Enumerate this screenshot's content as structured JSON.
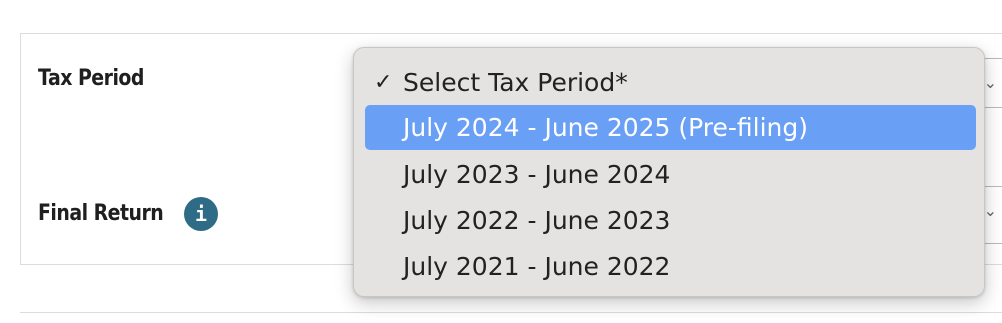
{
  "form": {
    "tax_period_label": "Tax Period",
    "final_return_label": "Final Return",
    "info_icon_glyph": "i"
  },
  "dropdown": {
    "check_glyph": "✓",
    "options": [
      {
        "label": "Select Tax Period*",
        "checked": true
      },
      {
        "label": "July 2024 - June 2025 (Pre-filing)",
        "highlighted": true
      },
      {
        "label": "July 2023 - June 2024"
      },
      {
        "label": "July 2022 - June 2023"
      },
      {
        "label": "July 2021 - June 2022"
      }
    ]
  },
  "colors": {
    "highlight": "#6a9ff6",
    "info_icon": "#2e6b86",
    "menu_background": "#e4e3e1"
  },
  "icons": {
    "info": "info-icon",
    "check": "checkmark-icon"
  }
}
